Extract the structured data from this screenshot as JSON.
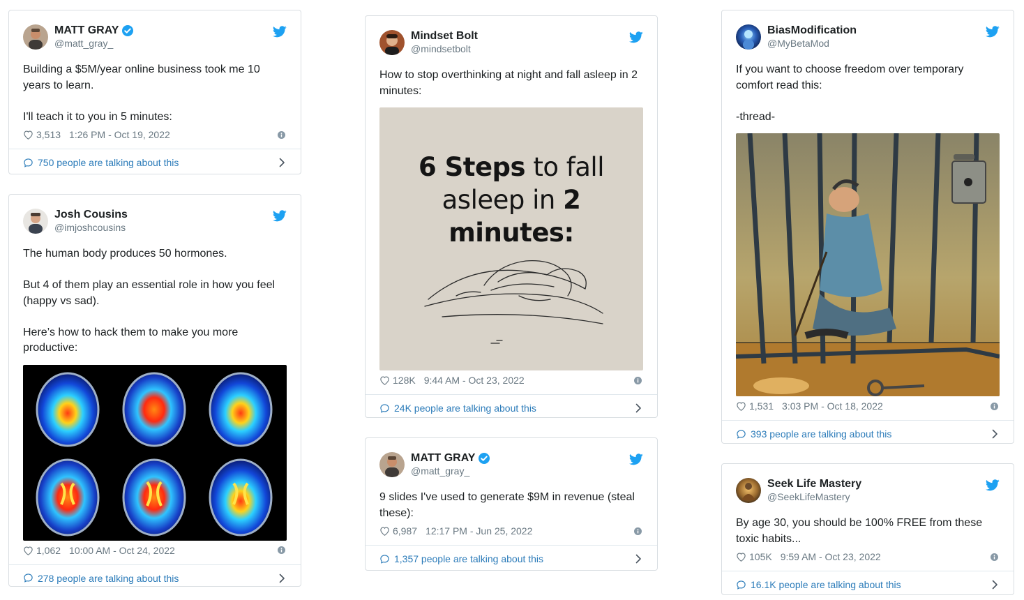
{
  "tweets": [
    {
      "display_name": "MATT GRAY",
      "verified": true,
      "handle": "@matt_gray_",
      "text": "Building a $5M/year online business took me 10 years to learn.\n\nI'll teach it to you in 5 minutes:",
      "likes": "3,513",
      "timestamp": "1:26 PM - Oct 19, 2022",
      "talking": "750 people are talking about this",
      "avatar_icon": "avatar-matt-gray"
    },
    {
      "display_name": "Josh Cousins",
      "verified": false,
      "handle": "@imjoshcousins",
      "text": "The human body produces 50 hormones.\n\nBut 4 of them play an essential role in how you feel (happy vs sad).\n\nHere’s how to hack them to make you more productive:",
      "likes": "1,062",
      "timestamp": "10:00 AM - Oct 24, 2022",
      "talking": "278 people are talking about this",
      "media": "brain-scans-image"
    },
    {
      "display_name": "Mindset Bolt",
      "verified": false,
      "handle": "@mindsetbolt",
      "text": "How to stop overthinking at night and fall asleep in 2 minutes:",
      "likes": "128K",
      "timestamp": "9:44 AM - Oct 23, 2022",
      "talking": "24K people are talking about this",
      "media": "sleep-sketch-image",
      "media_text": {
        "line1_bold": "6 Steps",
        "line1_rest": " to fall",
        "line2_rest": "asleep in ",
        "line2_bold": "2 minutes:"
      }
    },
    {
      "display_name": "MATT GRAY",
      "verified": true,
      "handle": "@matt_gray_",
      "text": "9 slides I've used to generate $9M in revenue (steal these):",
      "likes": "6,987",
      "timestamp": "12:17 PM - Jun 25, 2022",
      "talking": "1,357 people are talking about this"
    },
    {
      "display_name": "BiasModification",
      "verified": false,
      "handle": "@MyBetaMod",
      "text": "If you want to choose freedom over temporary comfort read this:\n\n-thread-",
      "likes": "1,531",
      "timestamp": "3:03 PM - Oct 18, 2022",
      "talking": "393 people are talking about this",
      "media": "prison-cartoon-image"
    },
    {
      "display_name": "Seek Life Mastery",
      "verified": false,
      "handle": "@SeekLifeMastery",
      "text": "By age 30, you should be 100% FREE from these toxic habits...",
      "likes": "105K",
      "timestamp": "9:59 AM - Oct 23, 2022",
      "talking": "16.1K people are talking about this"
    }
  ],
  "colors": {
    "twitter_blue": "#1da1f2",
    "link_blue": "#2b7bb9",
    "muted": "#697882",
    "border": "#d9dee2"
  }
}
